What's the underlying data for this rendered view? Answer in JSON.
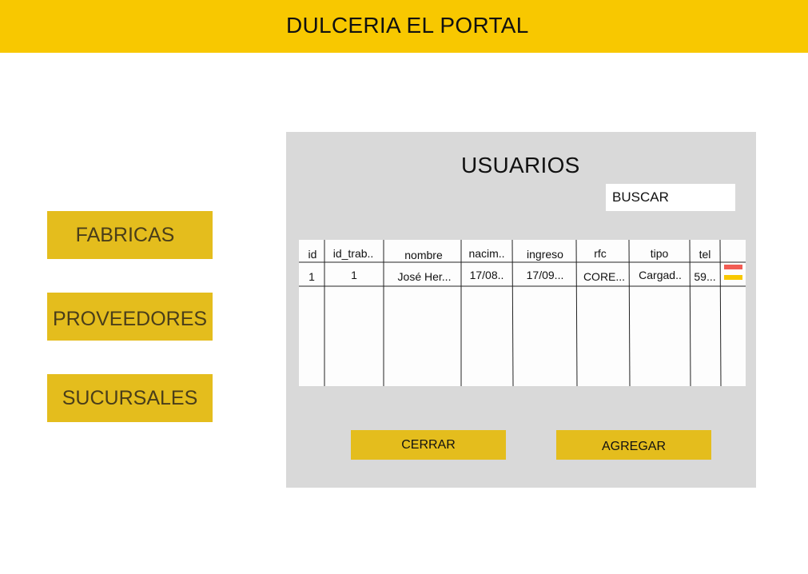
{
  "header": {
    "title": "DULCERIA EL PORTAL"
  },
  "nav": {
    "fabricas": "FABRICAS",
    "proveedores": "PROVEEDORES",
    "sucursales": "SUCURSALES"
  },
  "panel": {
    "title": "USUARIOS",
    "search_placeholder": "BUSCAR",
    "table": {
      "headers": [
        "id",
        "id_trab..",
        "nombre",
        "nacim..",
        "ingreso",
        "rfc",
        "tipo",
        "tel"
      ],
      "rows": [
        [
          "1",
          "1",
          "José Her...",
          "17/08..",
          "17/09...",
          "CORE...",
          "Cargad..",
          "59..."
        ]
      ],
      "row_action_colors": [
        "#f25c54",
        "#f8c800"
      ]
    },
    "buttons": {
      "cerrar": "CERRAR",
      "agregar": "AGREGAR"
    }
  },
  "colors": {
    "header_bg": "#f8c800",
    "button_bg": "#e4bd1d",
    "panel_bg": "#d9d9d9"
  }
}
